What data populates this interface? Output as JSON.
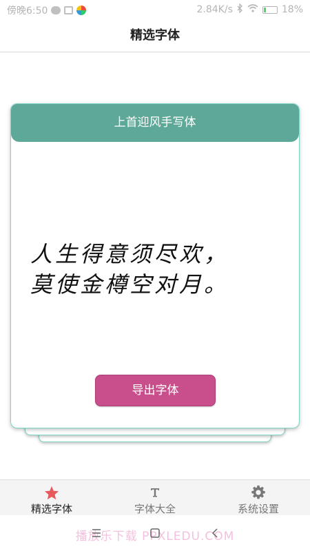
{
  "status_bar": {
    "time": "傍晚6:50",
    "net_speed": "2.84K/s",
    "battery": "18%",
    "battery_level": 0.18
  },
  "header": {
    "title": "精选字体"
  },
  "card": {
    "title": "上首迎风手写体",
    "sample_line1": "人生得意须尽欢，",
    "sample_line2": "莫使金樽空对月。",
    "export_label": "导出字体"
  },
  "bottom_nav": {
    "items": [
      {
        "label": "精选字体",
        "icon": "star-icon",
        "active": true
      },
      {
        "label": "字体大全",
        "icon": "type-icon",
        "active": false
      },
      {
        "label": "系统设置",
        "icon": "gear-icon",
        "active": false
      }
    ]
  },
  "system_nav": {
    "watermark": "播放乐下载 PPXLEDU.COM"
  },
  "colors": {
    "accent_teal": "#5ea899",
    "button_pink": "#c84f8b",
    "star_red": "#e8595c"
  }
}
